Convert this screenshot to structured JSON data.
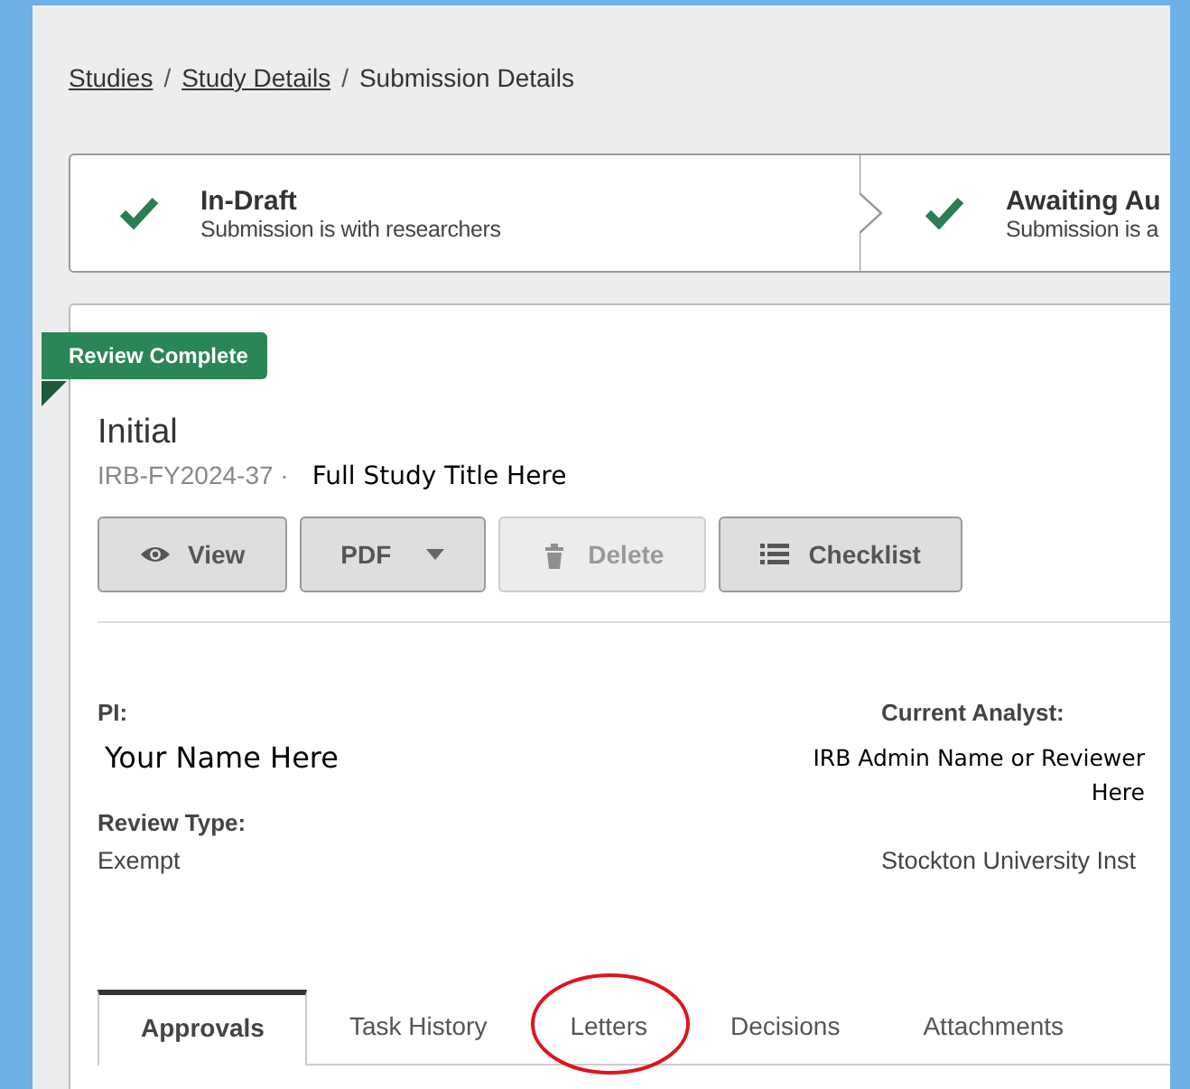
{
  "breadcrumb": {
    "separator": "/",
    "items": [
      {
        "label": "Studies",
        "link": true
      },
      {
        "label": "Study Details",
        "link": true
      },
      {
        "label": "Submission Details",
        "link": false
      }
    ]
  },
  "steps": [
    {
      "title": "In-Draft",
      "subtitle": "Submission is with researchers",
      "done": true
    },
    {
      "title": "Awaiting Au",
      "subtitle": "Submission is a",
      "done": true
    }
  ],
  "submission": {
    "badge": "Review Complete",
    "title": "Initial",
    "id": "IRB-FY2024-37 ·",
    "study_title": "Full Study Title Here"
  },
  "buttons": [
    {
      "label": "View",
      "kind": "view",
      "disabled": false
    },
    {
      "label": "PDF",
      "kind": "dropdown",
      "disabled": false
    },
    {
      "label": "Delete",
      "kind": "delete",
      "disabled": true
    },
    {
      "label": "Checklist",
      "kind": "checklist",
      "disabled": false
    }
  ],
  "details": {
    "pi_label": "PI:",
    "pi": "Your Name Here",
    "analyst_label": "Current Analyst:",
    "analyst": "IRB Admin Name or Reviewer Here",
    "review_type_label": "Review Type:",
    "review_type": "Exempt",
    "institution": "Stockton University Inst"
  },
  "tabs": [
    {
      "label": "Approvals",
      "selected": true,
      "circled": false
    },
    {
      "label": "Task History",
      "selected": false,
      "circled": false
    },
    {
      "label": "Letters",
      "selected": false,
      "circled": true
    },
    {
      "label": "Decisions",
      "selected": false,
      "circled": false
    },
    {
      "label": "Attachments",
      "selected": false,
      "circled": false
    }
  ]
}
